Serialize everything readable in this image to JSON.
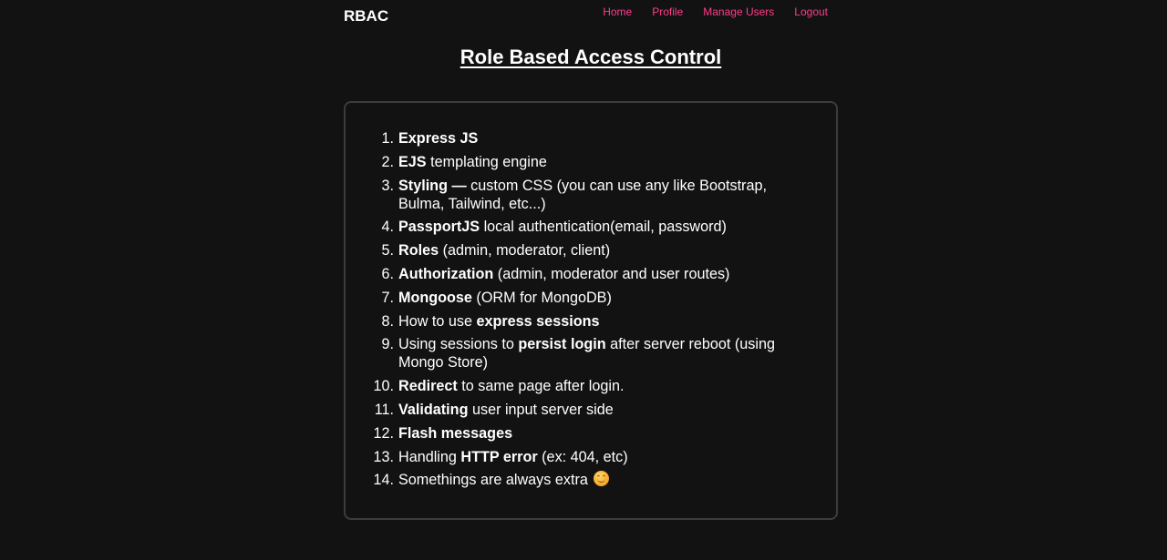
{
  "navbar": {
    "brand": "RBAC",
    "links": [
      "Home",
      "Profile",
      "Manage Users",
      "Logout"
    ]
  },
  "main": {
    "title": "Role Based Access Control",
    "features": [
      {
        "num": "1.",
        "parts": [
          {
            "b": "Express JS"
          }
        ]
      },
      {
        "num": "2.",
        "parts": [
          {
            "b": "EJS"
          },
          {
            "t": " templating engine"
          }
        ]
      },
      {
        "num": "3.",
        "parts": [
          {
            "b": "Styling —"
          },
          {
            "t": " custom CSS (you can use any like Bootstrap, Bulma, Tailwind, etc...)"
          }
        ]
      },
      {
        "num": "4.",
        "parts": [
          {
            "b": "PassportJS"
          },
          {
            "t": " local authentication(email, password)"
          }
        ]
      },
      {
        "num": "5.",
        "parts": [
          {
            "b": "Roles"
          },
          {
            "t": " (admin, moderator, client)"
          }
        ]
      },
      {
        "num": "6.",
        "parts": [
          {
            "b": "Authorization"
          },
          {
            "t": " (admin, moderator and user routes)"
          }
        ]
      },
      {
        "num": "7.",
        "parts": [
          {
            "b": "Mongoose"
          },
          {
            "t": " (ORM for MongoDB)"
          }
        ]
      },
      {
        "num": "8.",
        "parts": [
          {
            "t": "How to use "
          },
          {
            "b": "express sessions"
          }
        ]
      },
      {
        "num": "9.",
        "parts": [
          {
            "t": "Using sessions to "
          },
          {
            "b": "persist login"
          },
          {
            "t": " after server reboot (using Mongo Store)"
          }
        ]
      },
      {
        "num": "10.",
        "parts": [
          {
            "b": "Redirect"
          },
          {
            "t": " to same page after login."
          }
        ]
      },
      {
        "num": "11.",
        "parts": [
          {
            "b": "Validating"
          },
          {
            "t": " user input server side"
          }
        ]
      },
      {
        "num": "12.",
        "parts": [
          {
            "b": "Flash messages"
          }
        ]
      },
      {
        "num": "13.",
        "parts": [
          {
            "t": "Handling "
          },
          {
            "b": "HTTP error"
          },
          {
            "t": " (ex: 404, etc)"
          }
        ]
      },
      {
        "num": "14.",
        "parts": [
          {
            "t": "Somethings are always extra"
          }
        ],
        "icon": "smiling-face-emoji-icon"
      }
    ]
  },
  "colors": {
    "background": "#121212",
    "nav_link": "#ff3b8a",
    "card_border": "#3c3c3c"
  }
}
